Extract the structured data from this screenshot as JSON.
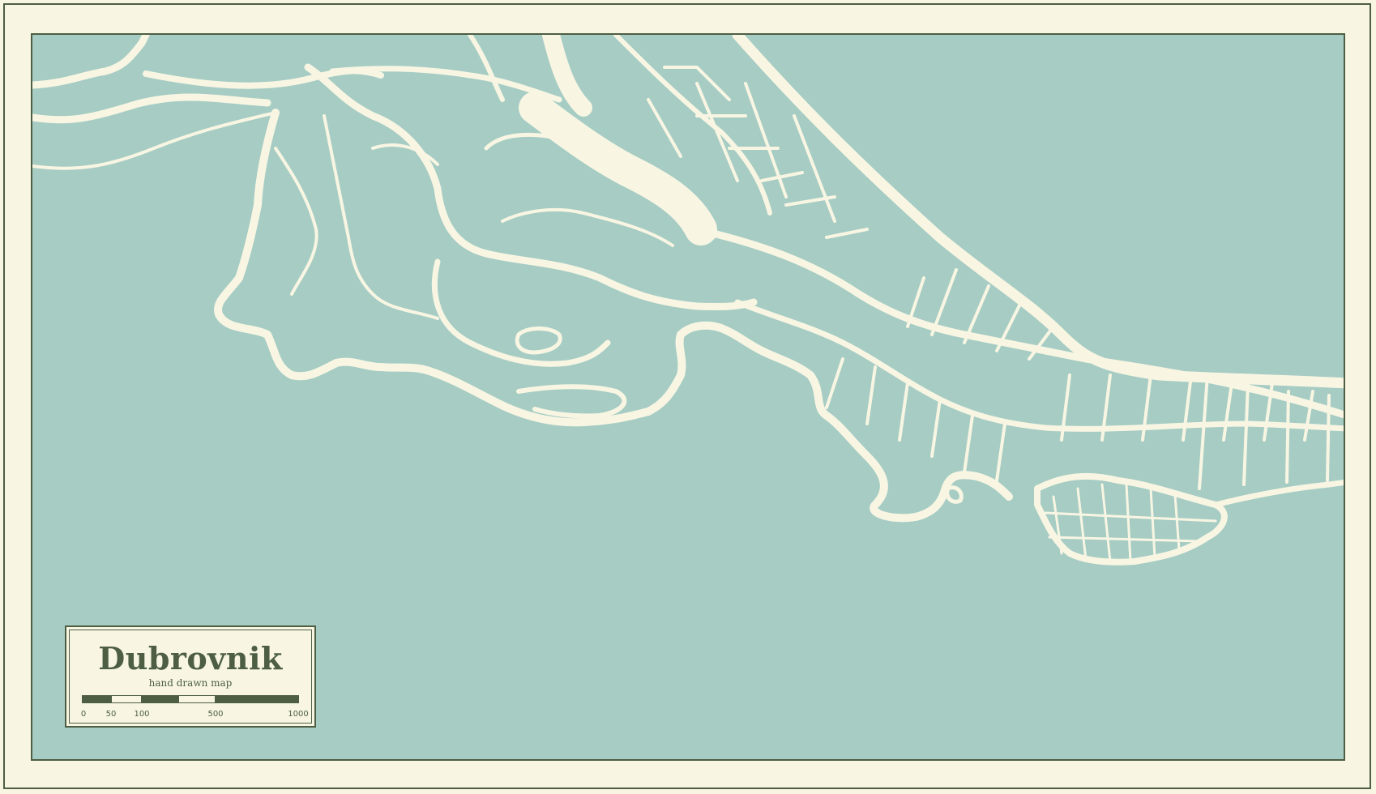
{
  "map": {
    "city_name": "Dubrovnik",
    "subtitle": "hand drawn map",
    "colors": {
      "background": "#f8f6e3",
      "water": "#a6ccc4",
      "roads": "#f8f6e3",
      "border": "#4d5e43",
      "text": "#4d5e43"
    },
    "scale": {
      "labels": [
        "0",
        "50",
        "100",
        "500",
        "1000"
      ]
    }
  }
}
